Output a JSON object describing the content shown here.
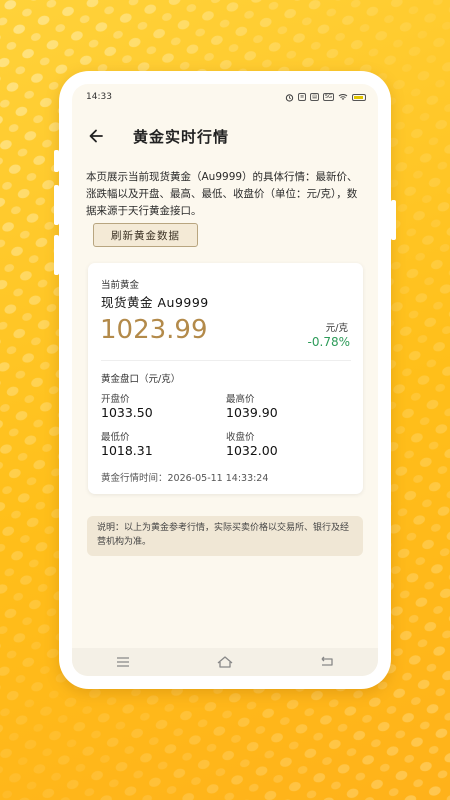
{
  "status_bar": {
    "time": "14:33",
    "icons": [
      "alarm-icon",
      "speed-icon",
      "sim-icon",
      "signal-5g-icon",
      "wifi-icon",
      "battery-icon"
    ],
    "battery": "4"
  },
  "header": {
    "title": "黄金实时行情",
    "back_icon": "arrow-left-icon"
  },
  "intro_text": "本页展示当前现货黄金（Au9999）的具体行情：最新价、涨跌幅以及开盘、最高、最低、收盘价（单位：元/克），数据来源于天行黄金接口。",
  "refresh_button": "刷新黄金数据",
  "card": {
    "label": "当前黄金",
    "name": "现货黄金  Au9999",
    "price": "1023.99",
    "unit": "元/克",
    "change": "-0.78%",
    "section_title": "黄金盘口（元/克）",
    "open_label": "开盘价",
    "open_value": "1033.50",
    "high_label": "最高价",
    "high_value": "1039.90",
    "low_label": "最低价",
    "low_value": "1018.31",
    "close_label": "收盘价",
    "close_value": "1032.00",
    "time_text": "黄金行情时间：2026-05-11  14:33:24"
  },
  "notice": "说明：以上为黄金参考行情，实际买卖价格以交易所、银行及经营机构为准。",
  "nav": {
    "menu_icon": "menu-icon",
    "home_icon": "home-icon",
    "back_icon": "back-icon"
  },
  "colors": {
    "background": "#ffc62a",
    "price": "#b38a4a",
    "change_negative": "#2d9b59",
    "button_bg": "#f4ead6"
  }
}
